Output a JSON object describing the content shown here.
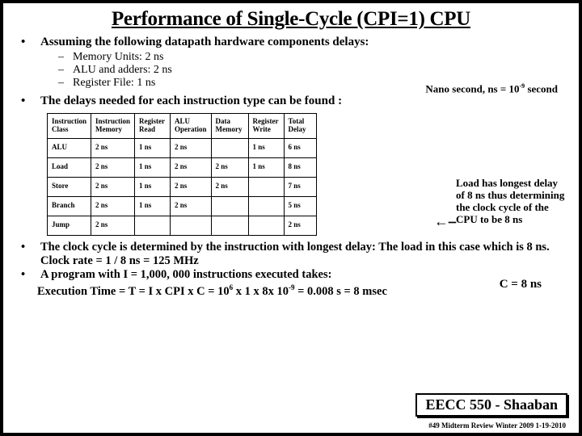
{
  "title": "Performance of Single-Cycle  (CPI=1)  CPU",
  "p1": "Assuming the following datapath hardware components delays:",
  "d1": "Memory Units:  2 ns",
  "d2": "ALU and adders:  2 ns",
  "d3": "Register File:  1 ns",
  "nano": "Nano second, ns  =  10",
  "nano_exp": "-9",
  "nano_tail": " second",
  "p2": "The delays needed for each instruction type can be found :",
  "th": [
    "Instruction Class",
    "Instruction Memory",
    "Register Read",
    "ALU Operation",
    "Data Memory",
    "Register Write",
    "Total Delay"
  ],
  "rows": [
    [
      "ALU",
      "2 ns",
      "1 ns",
      "2 ns",
      "",
      "1 ns",
      "6 ns"
    ],
    [
      "Load",
      "2 ns",
      "1 ns",
      "2 ns",
      "2 ns",
      "1 ns",
      "8 ns"
    ],
    [
      "Store",
      "2 ns",
      "1 ns",
      "2 ns",
      "2 ns",
      "",
      "7 ns"
    ],
    [
      "Branch",
      "2 ns",
      "1 ns",
      "2 ns",
      "",
      "",
      "5 ns"
    ],
    [
      "Jump",
      "2 ns",
      "",
      "",
      "",
      "",
      "2 ns"
    ]
  ],
  "side": "Load has longest delay of 8 ns thus determining the clock cycle of the CPU to be 8 ns",
  "cval": "C =  8 ns",
  "p3": "The clock cycle is determined by the instruction with longest delay:  The load in this case which is 8 ns.   Clock rate =  1 / 8 ns  =  125 MHz",
  "p4": "A program with I = 1,000, 000 instructions executed takes:",
  "eq_a": "Execution Time  =  T  =  I  x CPI  x C =  10",
  "eq_b": "6",
  "eq_c": "    x  1  x   8x 10",
  "eq_d": "-9",
  "eq_e": "  =  0.008 s = 8 msec",
  "sig": "EECC 550 - Shaaban",
  "foot": "#49   Midterm Review  Winter 2009  1-19-2010",
  "chart_data": {
    "type": "table",
    "title": "Instruction type delays (ns)",
    "columns": [
      "Instruction Class",
      "Instruction Memory",
      "Register Read",
      "ALU Operation",
      "Data Memory",
      "Register Write",
      "Total Delay"
    ],
    "rows": [
      {
        "class": "ALU",
        "imem": 2,
        "rread": 1,
        "alu": 2,
        "dmem": null,
        "rwrite": 1,
        "total": 6
      },
      {
        "class": "Load",
        "imem": 2,
        "rread": 1,
        "alu": 2,
        "dmem": 2,
        "rwrite": 1,
        "total": 8
      },
      {
        "class": "Store",
        "imem": 2,
        "rread": 1,
        "alu": 2,
        "dmem": 2,
        "rwrite": null,
        "total": 7
      },
      {
        "class": "Branch",
        "imem": 2,
        "rread": 1,
        "alu": 2,
        "dmem": null,
        "rwrite": null,
        "total": 5
      },
      {
        "class": "Jump",
        "imem": 2,
        "rread": null,
        "alu": null,
        "dmem": null,
        "rwrite": null,
        "total": 2
      }
    ]
  }
}
